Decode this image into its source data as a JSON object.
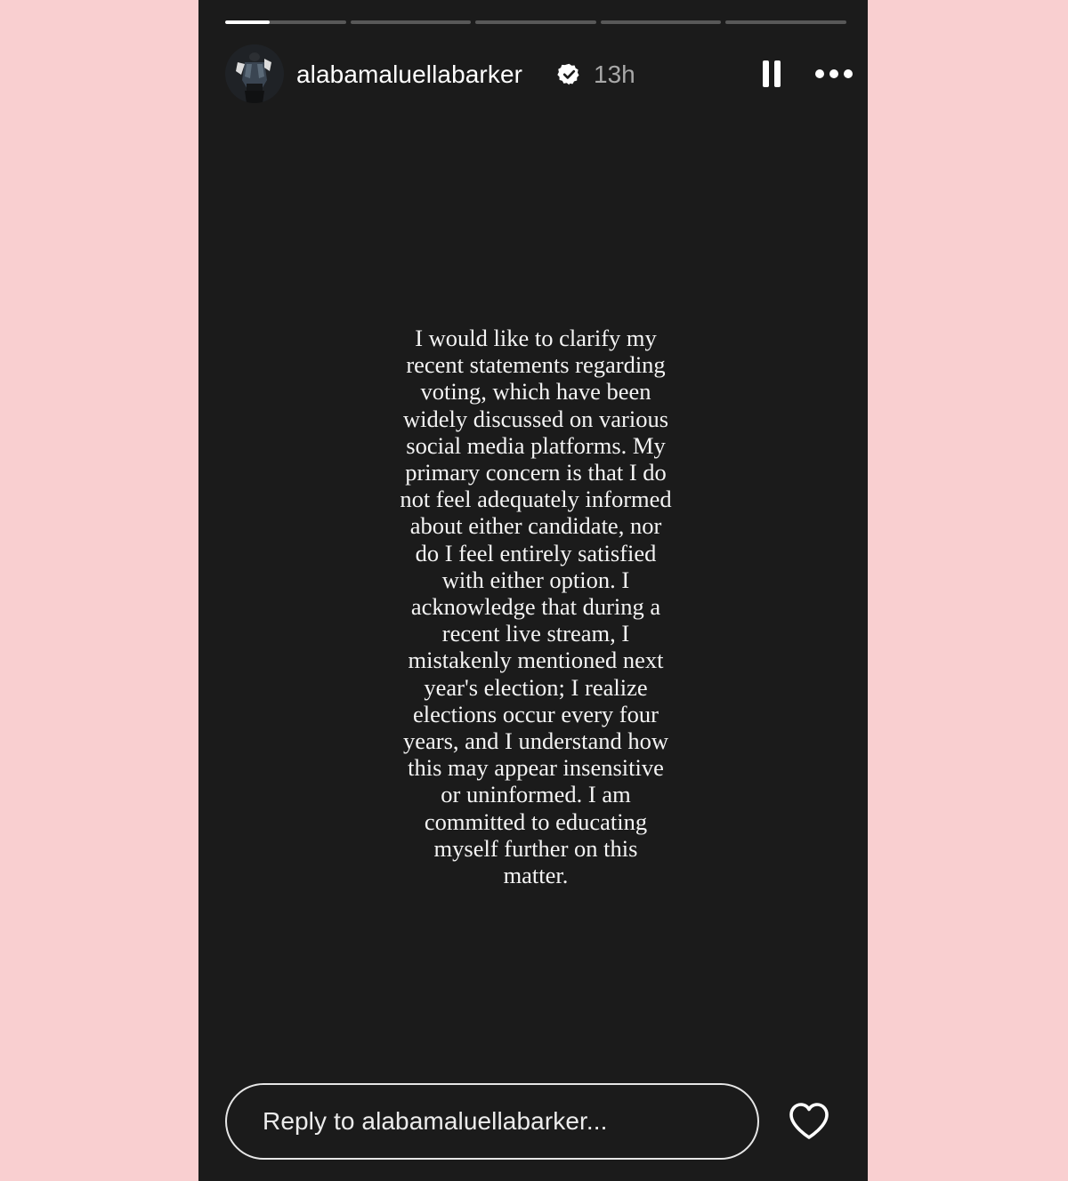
{
  "story": {
    "progress": {
      "segment_count": 5,
      "current_segment_progress": 0.37,
      "completed_segments": 0
    },
    "header": {
      "username": "alabamaluellabarker",
      "timestamp": "13h",
      "verified": true,
      "icons": {
        "verified": "verified-badge-icon",
        "pause": "pause-icon",
        "more": "more-options-icon"
      }
    },
    "text": "I would like to clarify my\nrecent statements regarding\nvoting, which have been\nwidely discussed on various\nsocial media platforms. My\nprimary concern is that I do\nnot feel adequately informed\nabout either candidate, nor\ndo I feel entirely satisfied\nwith either option. I\nacknowledge that during a\nrecent live stream, I\nmistakenly mentioned next\nyear's election; I realize\nelections occur every four\nyears, and I understand how\nthis may appear insensitive\nor uninformed. I am\ncommitted to educating\nmyself further on this\nmatter.",
    "reply": {
      "placeholder": "Reply to alabamaluellabarker..."
    },
    "icons": {
      "like": "heart-icon"
    }
  },
  "colors": {
    "page_background": "#f9cfd0",
    "story_background": "#1b1b1b",
    "text": "#f4f4f4",
    "timestamp": "#a8a8a8"
  }
}
